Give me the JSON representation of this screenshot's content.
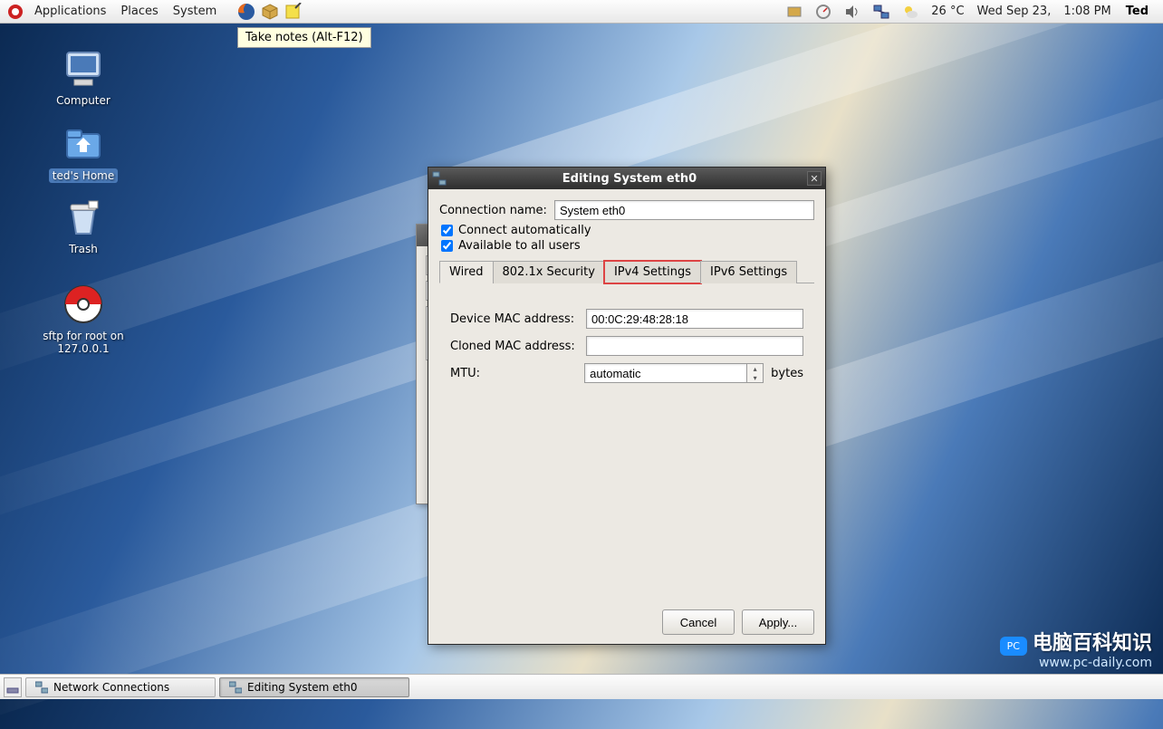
{
  "panel": {
    "menus": [
      "Applications",
      "Places",
      "System"
    ],
    "tooltip": "Take notes (Alt-F12)",
    "weather": "26 °C",
    "date": "Wed Sep 23,",
    "time": "1:08 PM",
    "user": "Ted"
  },
  "desktop": {
    "computer": "Computer",
    "home": "ted's Home",
    "trash": "Trash",
    "sftp": "sftp for root on 127.0.0.1"
  },
  "dialog": {
    "title": "Editing System eth0",
    "conn_name_label": "Connection name:",
    "conn_name_value": "System eth0",
    "auto_label": "Connect automatically",
    "avail_label": "Available to all users",
    "tabs": {
      "wired": "Wired",
      "sec": "802.1x Security",
      "ipv4": "IPv4 Settings",
      "ipv6": "IPv6 Settings"
    },
    "mac_label": "Device MAC address:",
    "mac_value": "00:0C:29:48:28:18",
    "cloned_label": "Cloned MAC address:",
    "cloned_value": "",
    "mtu_label": "MTU:",
    "mtu_value": "automatic",
    "mtu_unit": "bytes",
    "cancel": "Cancel",
    "apply": "Apply..."
  },
  "taskbar": {
    "t1": "Network Connections",
    "t2": "Editing System eth0"
  },
  "watermark": {
    "line1": "电脑百科知识",
    "line2": "www.pc-daily.com",
    "badge": "PC"
  }
}
